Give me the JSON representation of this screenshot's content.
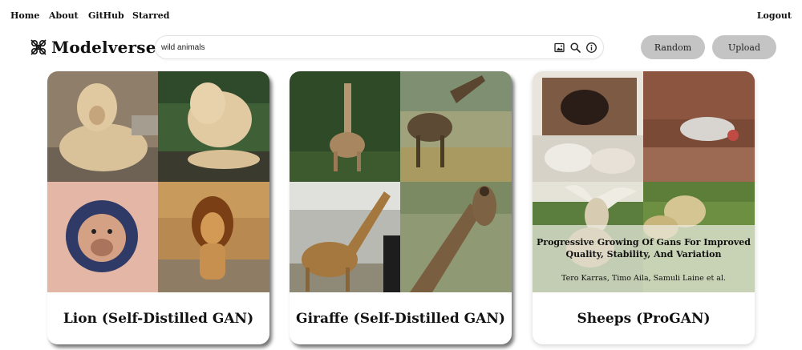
{
  "nav": {
    "home": "Home",
    "about": "About",
    "github": "GitHub",
    "starred": "Starred",
    "logout": "Logout"
  },
  "brand": {
    "name": "Modelverse"
  },
  "search": {
    "value": "wild animals",
    "icons": [
      "image-search-icon",
      "search-icon",
      "info-icon"
    ]
  },
  "actions": {
    "random": "Random",
    "upload": "Upload"
  },
  "cards": [
    {
      "title": "Lion (Self-Distilled GAN)",
      "images": [
        "lioness lying on rocks",
        "lioness resting on grass",
        "lion head tattoo",
        "male lion walking"
      ]
    },
    {
      "title": "Giraffe (Self-Distilled GAN)",
      "images": [
        "giraffe among trees",
        "giraffe in savanna",
        "giraffe walking",
        "giraffe close-up"
      ]
    },
    {
      "title": "Sheeps (ProGAN)",
      "images": [
        "generated animal on dirt",
        "generated sheep on brown field",
        "generated goat on grass",
        "generated sheep in meadow"
      ],
      "paper": {
        "title": "Progressive Growing Of Gans For Improved Quality, Stability, And Variation",
        "authors": "Tero Karras, Timo Aila, Samuli Laine et al."
      }
    }
  ],
  "colors": {
    "button_bg": "#c4c4c4",
    "text": "#111111",
    "background": "#ffffff"
  }
}
